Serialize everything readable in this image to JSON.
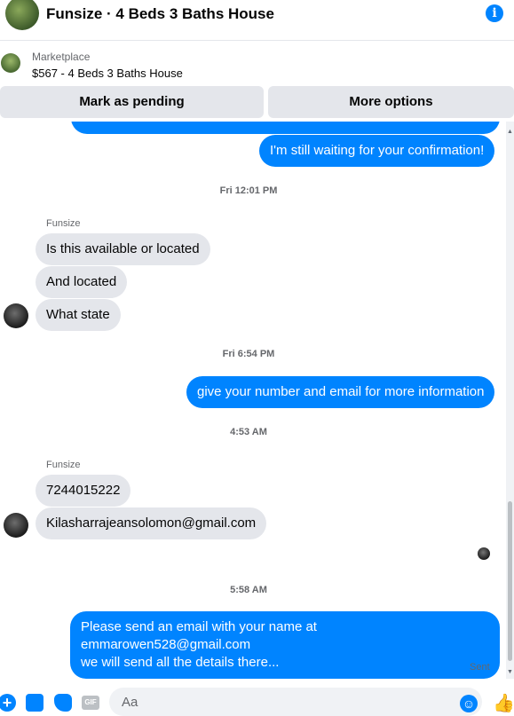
{
  "header": {
    "title": "Funsize · 4 Beds 3 Baths House",
    "info_icon": "info-icon"
  },
  "listing": {
    "label": "Marketplace",
    "summary": "$567 - 4 Beds 3 Baths House"
  },
  "actions": {
    "mark_pending": "Mark as pending",
    "more_options": "More options"
  },
  "messages": {
    "out_1": "I'm still waiting for your confirmation!",
    "ts_1": "Fri 12:01 PM",
    "sender_1": "Funsize",
    "in_1": "Is this available or located",
    "in_2": "And located",
    "in_3": "What state",
    "ts_2": "Fri 6:54 PM",
    "out_2": "give your number and email for more information",
    "ts_3": "4:53 AM",
    "sender_2": "Funsize",
    "in_4": "7244015222",
    "in_5": "Kilasharrajeansolomon@gmail.com",
    "ts_4": "5:58 AM",
    "out_3_line1": "Please send an email with your name at emmarowen528@gmail.com",
    "out_3_line2": "we will send all the details there...",
    "status": "Sent"
  },
  "composer": {
    "placeholder": "Aa",
    "gif_label": "GIF",
    "plus": "+"
  },
  "colors": {
    "accent": "#0084ff",
    "incoming_bubble": "#e4e6eb",
    "button_bg": "#e4e6eb"
  }
}
